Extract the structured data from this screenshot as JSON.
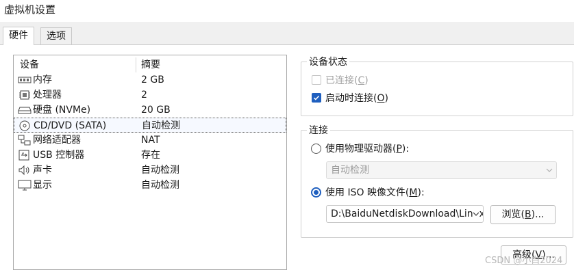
{
  "window": {
    "title": "虚拟机设置"
  },
  "tabs": [
    {
      "label": "硬件",
      "active": true
    },
    {
      "label": "选项",
      "active": false
    }
  ],
  "device_list": {
    "headers": {
      "device": "设备",
      "summary": "摘要"
    },
    "rows": [
      {
        "name": "内存",
        "summary": "2 GB",
        "icon": "memory-icon"
      },
      {
        "name": "处理器",
        "summary": "2",
        "icon": "processor-icon"
      },
      {
        "name": "硬盘 (NVMe)",
        "summary": "20 GB",
        "icon": "hard-disk-icon"
      },
      {
        "name": "CD/DVD (SATA)",
        "summary": "自动检测",
        "icon": "cd-dvd-icon",
        "selected": true
      },
      {
        "name": "网络适配器",
        "summary": "NAT",
        "icon": "network-adapter-icon"
      },
      {
        "name": "USB 控制器",
        "summary": "存在",
        "icon": "usb-icon"
      },
      {
        "name": "声卡",
        "summary": "自动检测",
        "icon": "speaker-icon"
      },
      {
        "name": "显示",
        "summary": "自动检测",
        "icon": "monitor-icon"
      }
    ]
  },
  "device_status": {
    "group_label": "设备状态",
    "connected": {
      "label_pre": "已连接(",
      "key": "C",
      "label_post": ")",
      "checked": false,
      "enabled": false
    },
    "connect_at_power_on": {
      "label_pre": "启动时连接(",
      "key": "O",
      "label_post": ")",
      "checked": true,
      "enabled": true
    }
  },
  "connection": {
    "group_label": "连接",
    "physical_drive": {
      "label_pre": "使用物理驱动器(",
      "key": "P",
      "label_post": "):",
      "selected": false
    },
    "physical_drive_combo": {
      "value": "自动检测"
    },
    "iso_image": {
      "label_pre": "使用 ISO 映像文件(",
      "key": "M",
      "label_post": "):",
      "selected": true
    },
    "iso_path": {
      "value": "D:\\BaiduNetdiskDownload\\Linux"
    },
    "browse_button": {
      "label_pre": "浏览(",
      "key": "B",
      "label_post": ")..."
    }
  },
  "advanced_button": {
    "label_pre": "高级(",
    "key": "V",
    "label_post": ")..."
  },
  "watermark": "CSDN @小白2024"
}
